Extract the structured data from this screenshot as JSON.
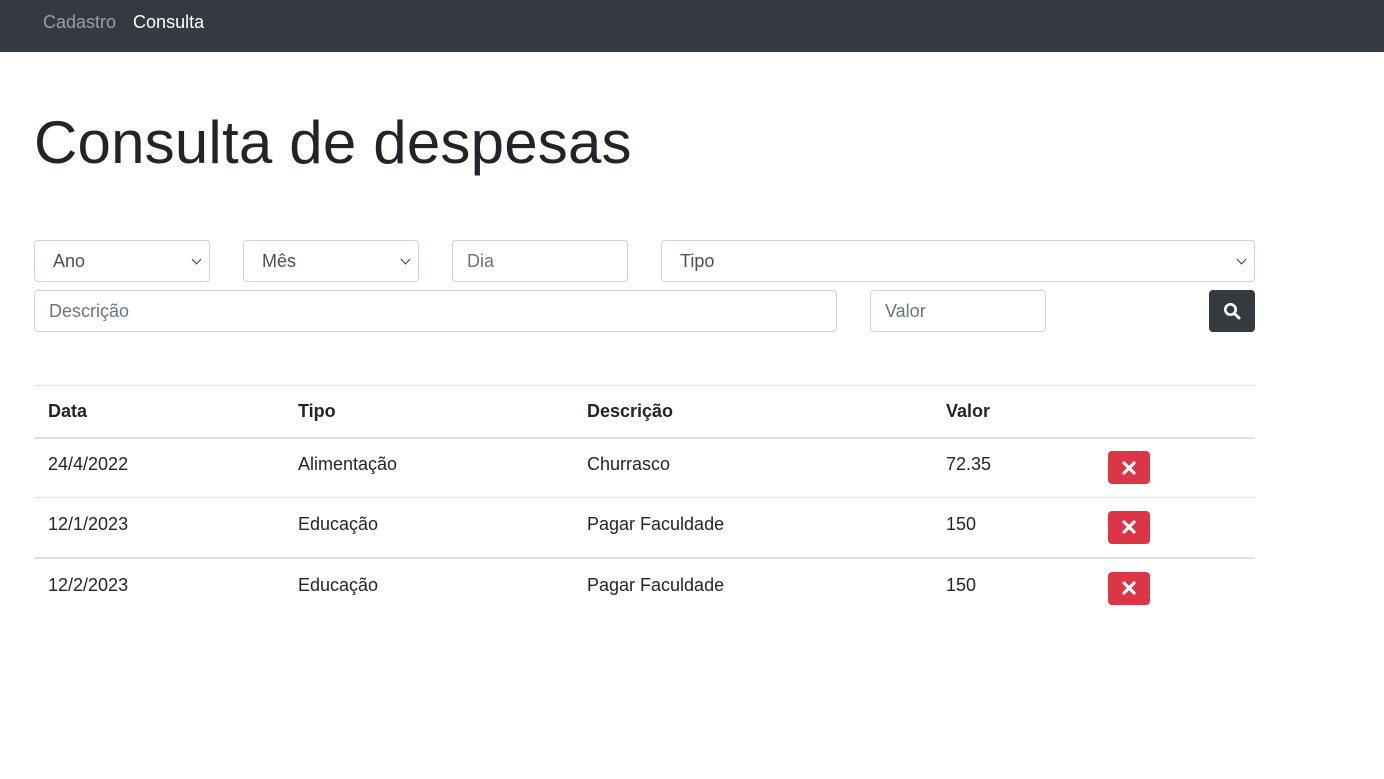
{
  "navbar": {
    "links": [
      {
        "label": "Cadastro"
      },
      {
        "label": "Consulta"
      }
    ]
  },
  "page": {
    "title": "Consulta de despesas"
  },
  "filters": {
    "ano": {
      "selected": "Ano"
    },
    "mes": {
      "selected": "Mês"
    },
    "dia": {
      "placeholder": "Dia"
    },
    "tipo": {
      "selected": "Tipo"
    },
    "descricao": {
      "placeholder": "Descrição"
    },
    "valor": {
      "placeholder": "Valor"
    }
  },
  "icons": {
    "search": "search-icon",
    "delete": "times-icon"
  },
  "colors": {
    "navbar": "#343a40",
    "delete": "#dc3545",
    "search_button": "#343a40"
  },
  "table": {
    "headers": [
      "Data",
      "Tipo",
      "Descrição",
      "Valor"
    ],
    "rows": [
      {
        "data": "24/4/2022",
        "tipo": "Alimentação",
        "descricao": "Churrasco",
        "valor": "72.35"
      },
      {
        "data": "12/1/2023",
        "tipo": "Educação",
        "descricao": "Pagar Faculdade",
        "valor": "150"
      },
      {
        "data": "12/2/2023",
        "tipo": "Educação",
        "descricao": "Pagar Faculdade",
        "valor": "150"
      }
    ]
  }
}
